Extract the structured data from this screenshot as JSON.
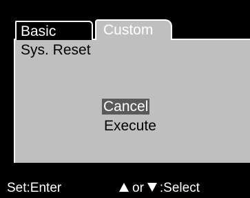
{
  "tabs": [
    {
      "label": "Basic",
      "selected": true
    },
    {
      "label": "Custom",
      "selected": false
    }
  ],
  "menu": {
    "title": "Sys. Reset",
    "options": [
      {
        "label": "Cancel",
        "selected": true
      },
      {
        "label": "Execute",
        "selected": false
      }
    ]
  },
  "footer": {
    "enter_hint": "Set:Enter",
    "or_text": "or",
    "select_hint": ":Select",
    "icons": [
      "up-arrow",
      "down-arrow"
    ]
  },
  "colors": {
    "background": "#000000",
    "panel": "#bfbfbf",
    "highlight": "#5a5a5a",
    "text_light": "#ffffff",
    "text_dark": "#000000"
  }
}
